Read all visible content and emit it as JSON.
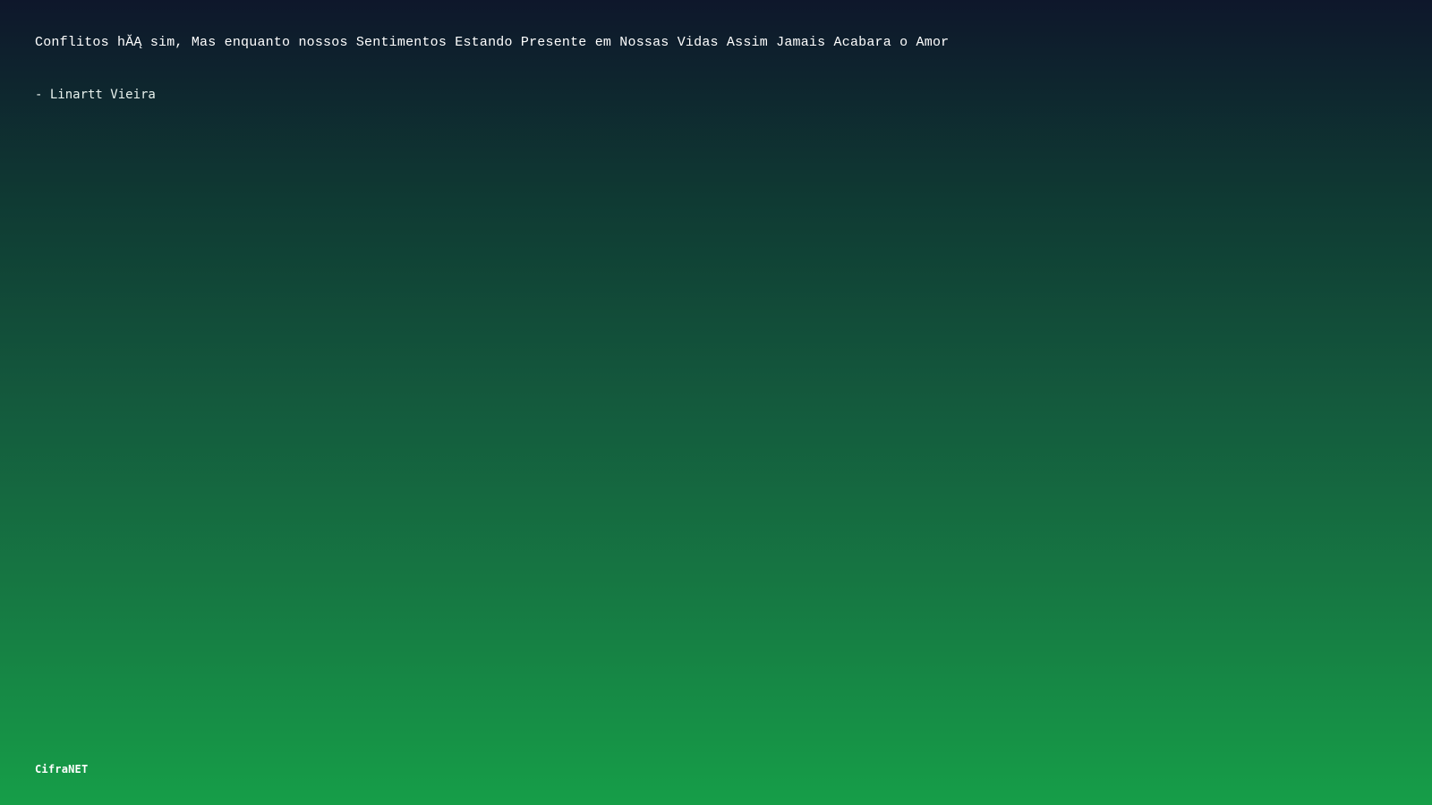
{
  "quote": {
    "text": "Conflitos hĂĄ sim, Mas enquanto nossos Sentimentos Estando Presente em Nossas Vidas Assim Jamais Acabara o Amor",
    "author": "- Linartt Vieira"
  },
  "brand": {
    "name": "CifraNET"
  },
  "colors": {
    "background_top": "#0e172b",
    "background_bottom": "#169e48",
    "text": "#ffffff"
  }
}
